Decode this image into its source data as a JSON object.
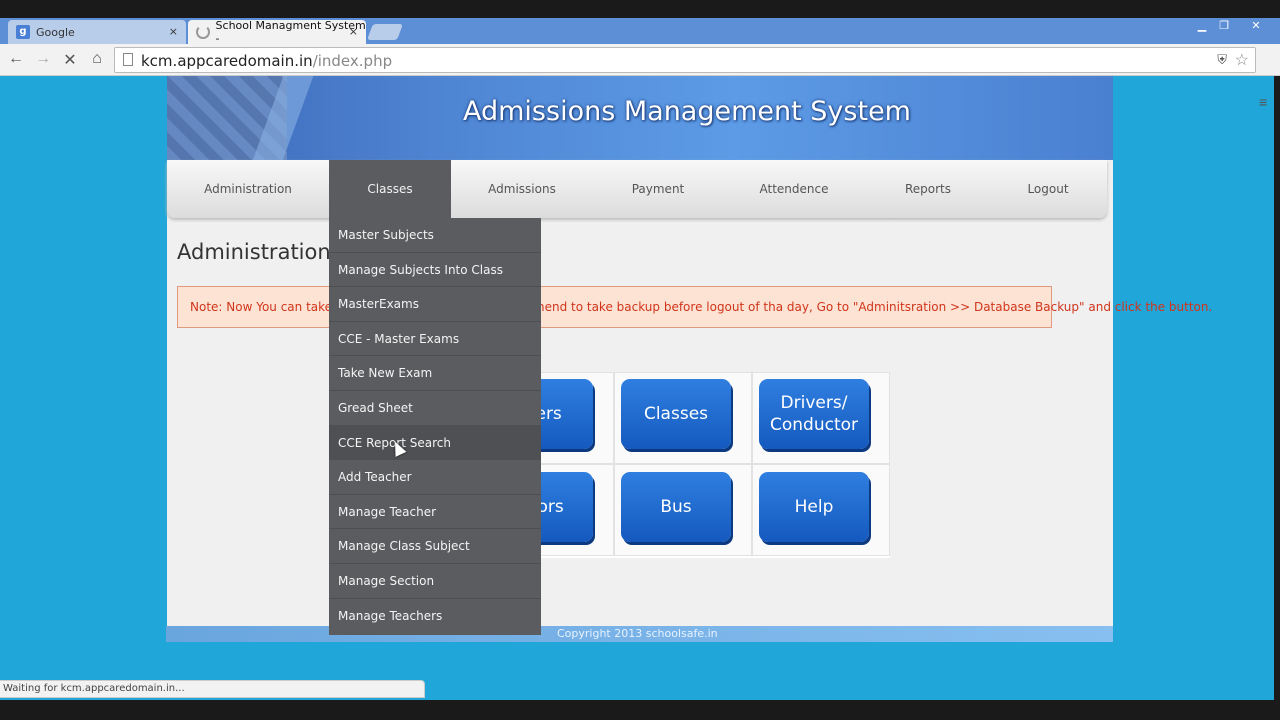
{
  "browser": {
    "tabs": [
      {
        "title": "Google",
        "close": "×"
      },
      {
        "title": "School Managment System -",
        "close": "×"
      }
    ],
    "url_host": "kcm.appcaredomain.in",
    "url_path": "/index.php",
    "status": "Waiting for kcm.appcaredomain.in..."
  },
  "site": {
    "title": "Admissions Management System",
    "nav": [
      "Administration",
      "Classes",
      "Admissions",
      "Payment",
      "Attendence",
      "Reports",
      "Logout"
    ],
    "active_nav": "Classes",
    "page_heading": "Administration",
    "note": "Note: Now You can take a backup of database. We recommend to take backup before logout of tha day, Go to \"Adminitsration >> Database Backup\" and click the button.",
    "tiles": [
      "Users",
      "Classes",
      "Drivers/ Conductor",
      "Tutors",
      "Bus",
      "Help"
    ],
    "footer": "Copyright 2013 schoolsafe.in"
  },
  "classes_menu": [
    "Master Subjects",
    "Manage Subjects Into Class",
    "MasterExams",
    "CCE - Master Exams",
    "Take New Exam",
    "Gread Sheet",
    "CCE Report Search",
    "Add Teacher",
    "Manage Teacher",
    "Manage Class Subject",
    "Manage Section",
    "Manage Teachers"
  ],
  "hovered_menu_item": "CCE Report Search",
  "colors": {
    "page_bg": "#20a6d8",
    "nav_active": "#5b5c5f",
    "tile": "#1f6bd0",
    "note_text": "#d0351b"
  }
}
